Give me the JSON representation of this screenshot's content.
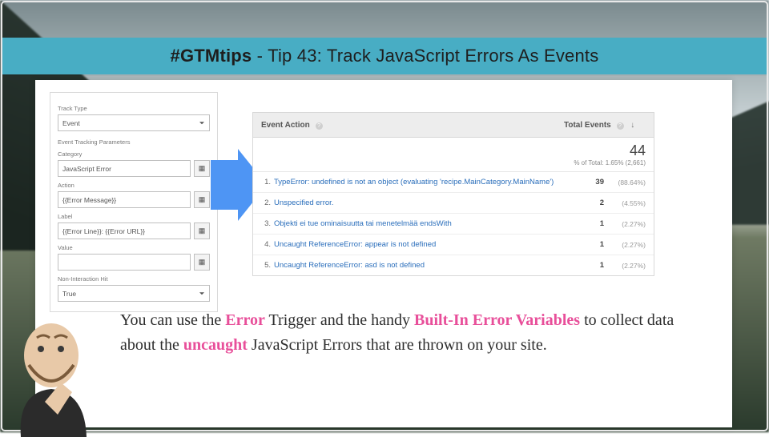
{
  "header": {
    "hashtag": "#GTMtips",
    "sep": " - ",
    "title": "Tip 43: Track JavaScript Errors As Events"
  },
  "gtm": {
    "track_type_label": "Track Type",
    "track_type_value": "Event",
    "params_heading": "Event Tracking Parameters",
    "category_label": "Category",
    "category_value": "JavaScript Error",
    "action_label": "Action",
    "action_value": "{{Error Message}}",
    "label_label": "Label",
    "label_value": "{{Error Line}}: {{Error URL}}",
    "value_label": "Value",
    "value_value": "",
    "nonint_label": "Non-Interaction Hit",
    "nonint_value": "True",
    "lego_glyph": "▦"
  },
  "ga": {
    "col_action": "Event Action",
    "col_total": "Total Events",
    "sort_glyph": "↓",
    "summary_value": "44",
    "summary_pct": "% of Total: 1.65% (2,661)",
    "rows": [
      {
        "n": "1.",
        "t": "TypeError: undefined is not an object (evaluating 'recipe.MainCategory.MainName')",
        "v": "39",
        "p": "(88.64%)"
      },
      {
        "n": "2.",
        "t": "Unspecified error.",
        "v": "2",
        "p": "(4.55%)"
      },
      {
        "n": "3.",
        "t": "Objekti ei tue ominaisuutta tai menetelmää endsWith",
        "v": "1",
        "p": "(2.27%)"
      },
      {
        "n": "4.",
        "t": "Uncaught ReferenceError: appear is not defined",
        "v": "1",
        "p": "(2.27%)"
      },
      {
        "n": "5.",
        "t": "Uncaught ReferenceError: asd is not defined",
        "v": "1",
        "p": "(2.27%)"
      }
    ]
  },
  "tip": {
    "p1a": "You can use the ",
    "p1b": "Error",
    "p1c": " Trigger and the handy ",
    "p1d": "Built-In Error Variables",
    "p1e": " to collect data about the ",
    "p1f": "uncaught",
    "p1g": " JavaScript Errors that are thrown on your site."
  }
}
